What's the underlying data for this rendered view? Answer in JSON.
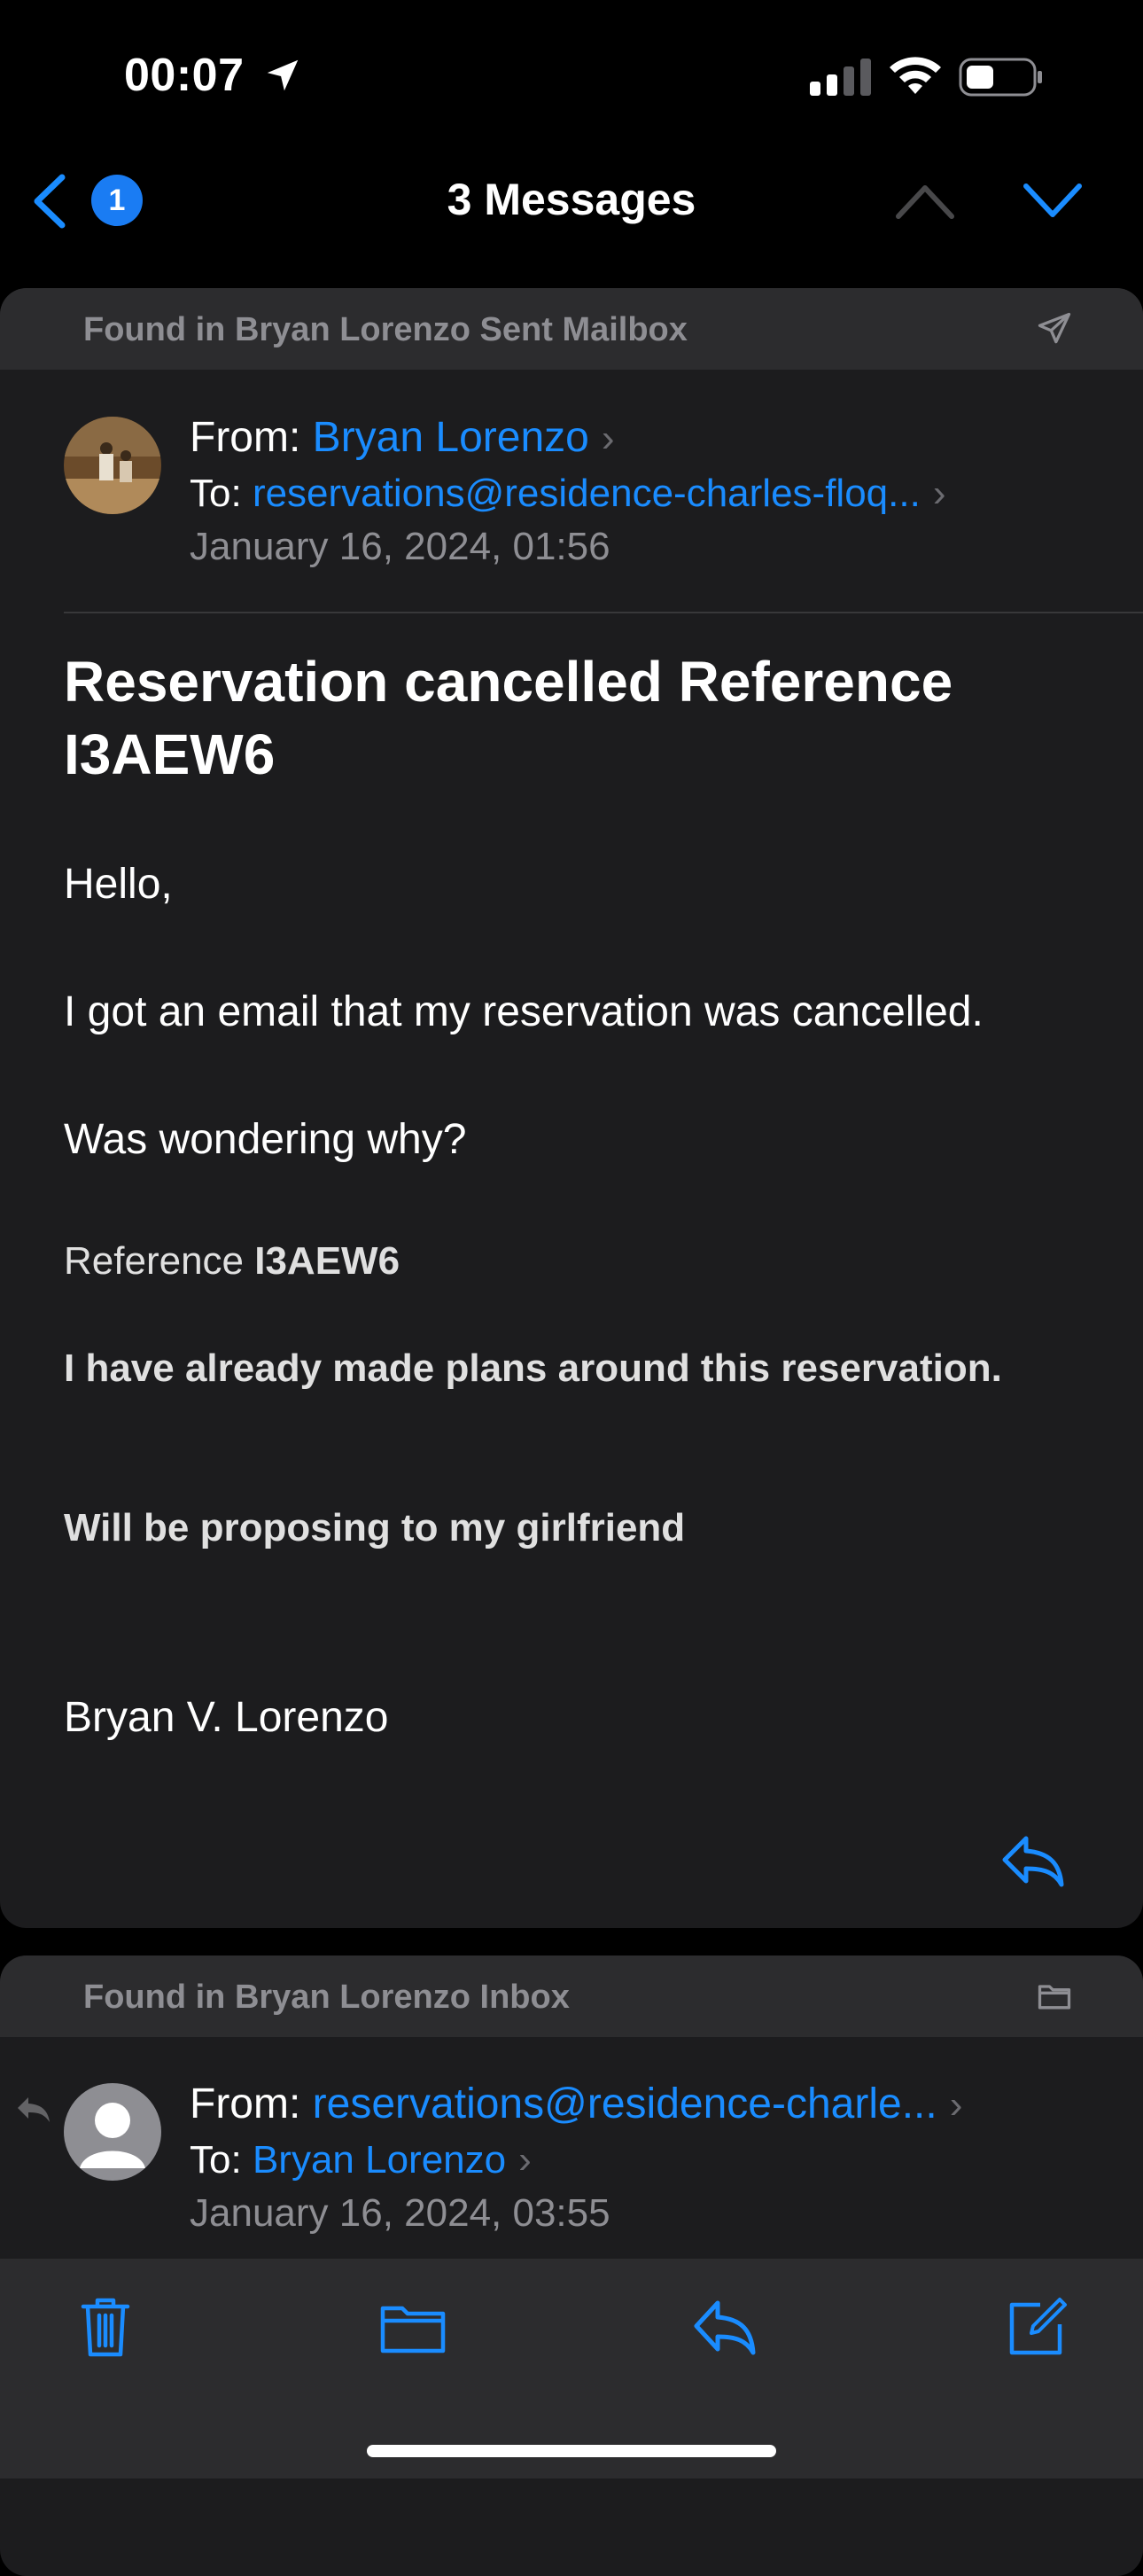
{
  "status_bar": {
    "time": "00:07"
  },
  "nav": {
    "badge": "1",
    "title": "3 Messages"
  },
  "message1": {
    "found_in": "Found in Bryan Lorenzo Sent Mailbox",
    "from_label": "From:",
    "from_name": "Bryan Lorenzo",
    "to_label": "To:",
    "to_address": "reservations@residence-charles-floq...",
    "date": "January 16, 2024, 01:56",
    "subject": "Reservation cancelled Reference I3AEW6",
    "body": {
      "greeting": "Hello,",
      "line1": "I got an email that my reservation was cancelled.",
      "line2": "Was wondering why?",
      "reference_label": "Reference ",
      "reference_code": "I3AEW6",
      "bold1": "I have already made plans around this reservation.",
      "bold2": "Will be proposing to my girlfriend",
      "signature": "Bryan V. Lorenzo"
    }
  },
  "message2": {
    "found_in": "Found in Bryan Lorenzo Inbox",
    "from_label": "From:",
    "from_address": "reservations@residence-charle...",
    "to_label": "To:",
    "to_name": "Bryan Lorenzo",
    "date": "January 16, 2024, 03:55"
  },
  "colors": {
    "accent": "#1a8cff",
    "background": "#000000",
    "card": "#1c1c1e",
    "card_header": "#2c2c2e",
    "secondary_text": "#8e8e93"
  },
  "icons": [
    "location-arrow-icon",
    "cellular-signal-icon",
    "wifi-icon",
    "battery-icon",
    "back-chevron-icon",
    "chevron-up-icon",
    "chevron-down-icon",
    "paper-plane-icon",
    "folder-icon",
    "reply-icon",
    "trash-icon",
    "move-folder-icon",
    "compose-icon"
  ]
}
